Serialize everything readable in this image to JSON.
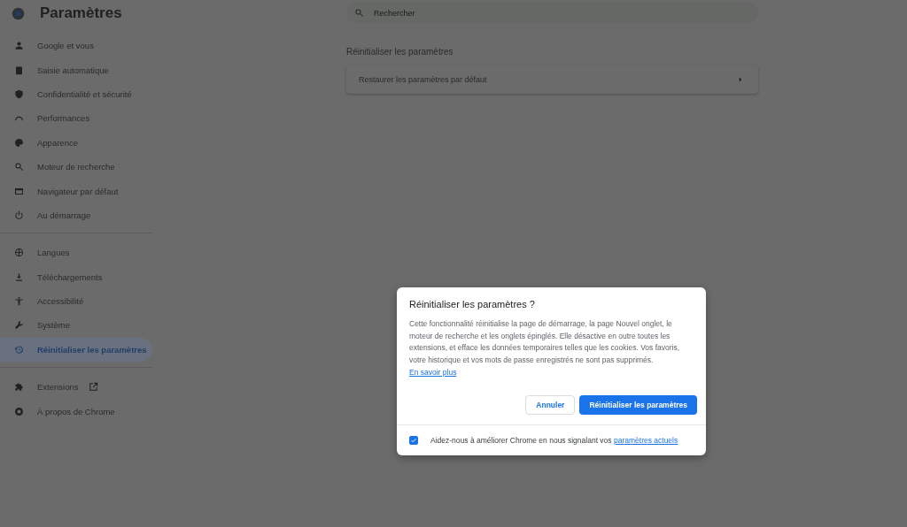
{
  "app_title": "Paramètres",
  "sidebar": {
    "groups": [
      [
        {
          "label": "Google et vous",
          "selected": false
        },
        {
          "label": "Saisie automatique",
          "selected": false
        },
        {
          "label": "Confidentialité et sécurité",
          "selected": false
        },
        {
          "label": "Performances",
          "selected": false
        },
        {
          "label": "Apparence",
          "selected": false
        },
        {
          "label": "Moteur de recherche",
          "selected": false
        },
        {
          "label": "Navigateur par défaut",
          "selected": false
        },
        {
          "label": "Au démarrage",
          "selected": false
        }
      ],
      [
        {
          "label": "Langues",
          "selected": false
        },
        {
          "label": "Téléchargements",
          "selected": false
        },
        {
          "label": "Accessibilité",
          "selected": false
        },
        {
          "label": "Système",
          "selected": false
        },
        {
          "label": "Réinitialiser les paramètres",
          "selected": true
        }
      ],
      [
        {
          "label": "Extensions",
          "selected": false,
          "external": true
        },
        {
          "label": "À propos de Chrome",
          "selected": false
        }
      ]
    ]
  },
  "search": {
    "placeholder": "Rechercher"
  },
  "section": {
    "title": "Réinitialiser les paramètres",
    "row": "Restaurer les paramètres par défaut"
  },
  "dialog": {
    "title": "Réinitialiser les paramètres ?",
    "body": "Cette fonctionnalité réinitialise la page de démarrage, la page Nouvel onglet, le moteur de recherche et les onglets épinglés. Elle désactive en outre toutes les extensions, et efface les données temporaires telles que les cookies. Vos favoris, votre historique et vos mots de passe enregistrés ne sont pas supprimés.",
    "link": "En savoir plus",
    "cancel": "Annuler",
    "confirm": "Réinitialiser les paramètres",
    "report": {
      "checked": true,
      "text": "Aidez-nous à améliorer Chrome en nous signalant vos",
      "link": "paramètres actuels"
    }
  }
}
